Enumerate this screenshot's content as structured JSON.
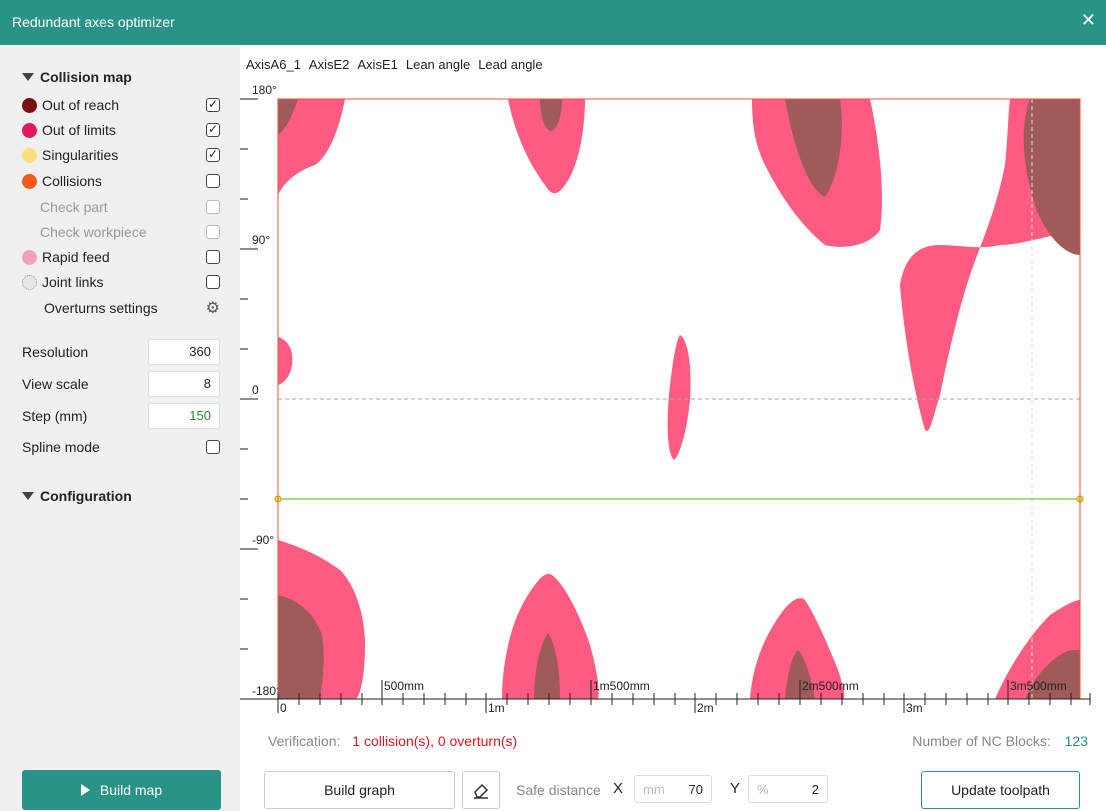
{
  "window": {
    "title": "Redundant axes optimizer",
    "close_glyph": "✕"
  },
  "sidebar": {
    "collision_map_header": "Collision map",
    "items": [
      {
        "label": "Out of reach",
        "color": "#7a0f12",
        "checked": true
      },
      {
        "label": "Out of limits",
        "color": "#e01a5a",
        "checked": true
      },
      {
        "label": "Singularities",
        "color": "#f9e07a",
        "checked": true
      },
      {
        "label": "Collisions",
        "color": "#f25a1c",
        "checked": false
      },
      {
        "label": "Check part",
        "checked": false,
        "disabled": true
      },
      {
        "label": "Check workpiece",
        "checked": false,
        "disabled": true
      },
      {
        "label": "Rapid feed",
        "color": "#f4a0b8",
        "checked": false
      },
      {
        "label": "Joint links",
        "icon": "dotted-circle-icon",
        "checked": false
      }
    ],
    "overturns_settings": "Overturns settings",
    "resolution_label": "Resolution",
    "resolution_value": "360",
    "view_scale_label": "View scale",
    "view_scale_value": "8",
    "step_label": "Step (mm)",
    "step_value": "150",
    "spline_mode_label": "Spline mode",
    "configuration_header": "Configuration",
    "build_map_label": "Build map"
  },
  "tabs": [
    "AxisA6_1",
    "AxisE2",
    "AxisE1",
    "Lean angle",
    "Lead angle"
  ],
  "active_tab": "AxisE2",
  "chart": {
    "y_labels": [
      "180°",
      "90°",
      "0",
      "-90°",
      "-180°"
    ],
    "x_labels": [
      "0",
      "500mm",
      "1m",
      "1m500mm",
      "2m",
      "2m500mm",
      "3m",
      "3m500mm"
    ],
    "colors": {
      "out_of_reach": "#a05a5a",
      "out_of_limits": "#ff5a82",
      "path_line": "#8fd14f",
      "frame": "#e8533a"
    }
  },
  "verification_label": "Verification:",
  "verification_value": "1 collision(s), 0 overturn(s)",
  "nc_blocks_label": "Number of NC Blocks:",
  "nc_blocks_value": "123",
  "bottom": {
    "build_graph": "Build graph",
    "safe_distance_label": "Safe distance",
    "x_axis": "X",
    "x_unit": "mm",
    "x_value": "70",
    "y_axis": "Y",
    "y_unit": "%",
    "y_value": "2",
    "update_toolpath": "Update toolpath"
  }
}
